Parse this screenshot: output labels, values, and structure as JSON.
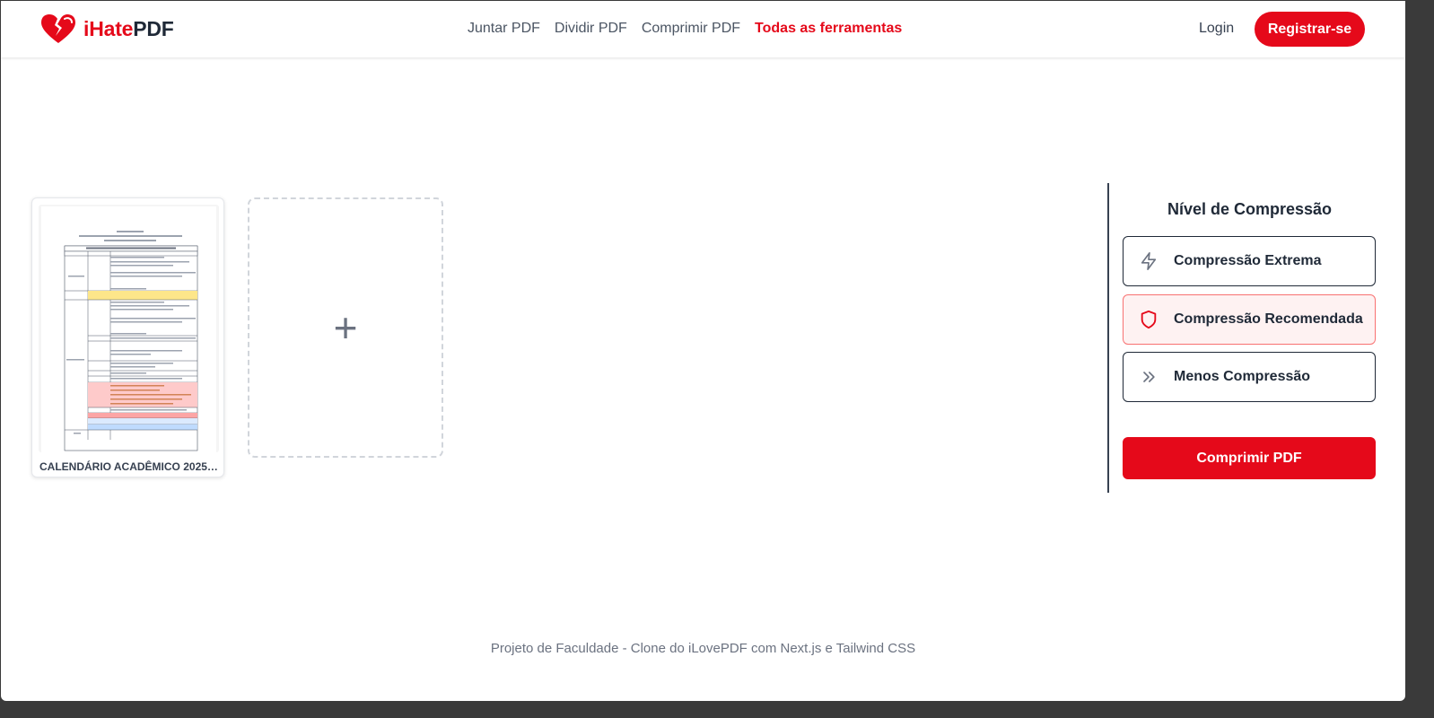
{
  "header": {
    "logo_part1": "iHate",
    "logo_part2": "PDF",
    "nav": [
      {
        "label": "Juntar PDF",
        "active": false
      },
      {
        "label": "Dividir PDF",
        "active": false
      },
      {
        "label": "Comprimir PDF",
        "active": false
      },
      {
        "label": "Todas as ferramentas",
        "active": true
      }
    ],
    "login_label": "Login",
    "register_label": "Registrar-se"
  },
  "files": {
    "items": [
      {
        "name": "CALENDÁRIO ACADÊMICO 2025 ..."
      }
    ],
    "add_symbol": "+"
  },
  "compression": {
    "title": "Nível de Compressão",
    "options": [
      {
        "label": "Compressão Extrema",
        "icon": "lightning-icon",
        "selected": false
      },
      {
        "label": "Compressão Recomendada",
        "icon": "shield-icon",
        "selected": true
      },
      {
        "label": "Menos Compressão",
        "icon": "double-chevron-right-icon",
        "selected": false
      }
    ],
    "action_label": "Comprimir PDF"
  },
  "footer": {
    "text": "Projeto de Faculdade - Clone do iLovePDF com Next.js e Tailwind CSS"
  },
  "colors": {
    "brand": "#e5091a",
    "selected_bg": "#fef2f2",
    "selected_border": "#f87171"
  }
}
